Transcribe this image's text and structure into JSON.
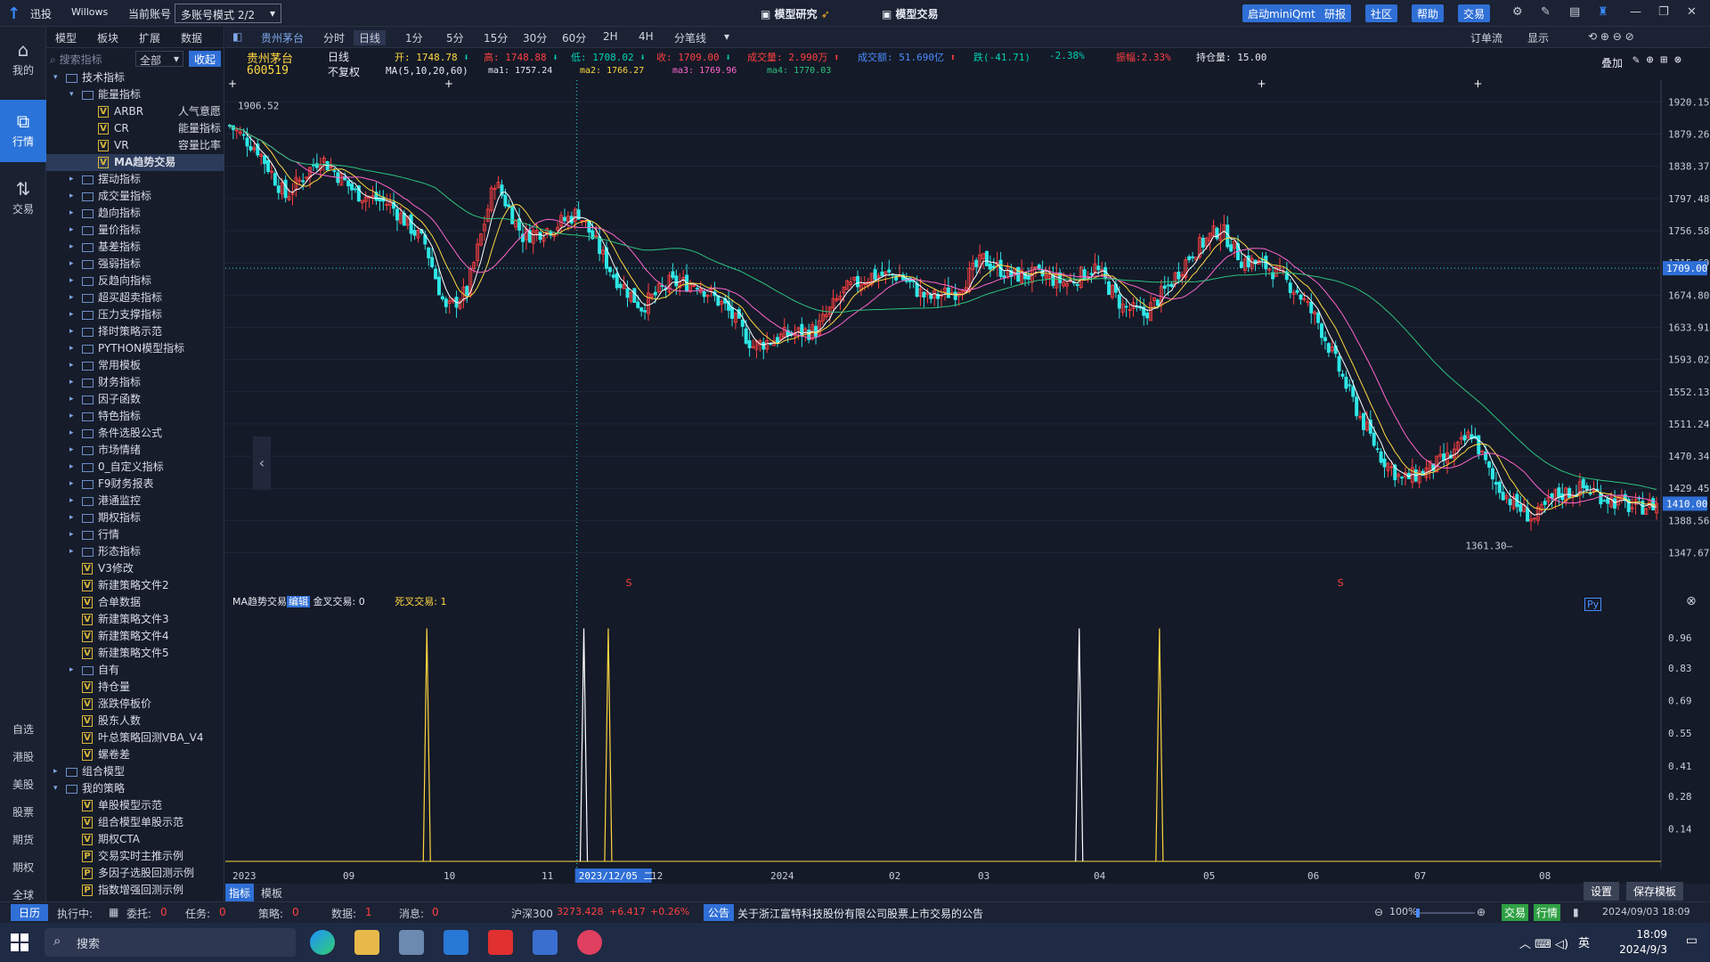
{
  "titlebar": {
    "brand": "迅投",
    "user": "Willows",
    "acct_label": "当前账号",
    "acct_value": "多账号模式 2/2",
    "center1": "模型研究",
    "center2": "模型交易",
    "buttons": [
      "启动miniQmt",
      "研报",
      "社区",
      "帮助",
      "交易"
    ]
  },
  "leftnav": {
    "items": [
      {
        "label": "我的",
        "icon": "home-icon"
      },
      {
        "label": "行情",
        "icon": "chart-icon"
      },
      {
        "label": "交易",
        "icon": "trade-icon"
      }
    ],
    "bottom": [
      "自选",
      "港股",
      "美股",
      "股票",
      "期货",
      "期权",
      "全球"
    ]
  },
  "tree": {
    "tabs": [
      "模型",
      "板块",
      "扩展",
      "数据"
    ],
    "search_placeholder": "搜索指标",
    "scope": "全部",
    "collapse": "收起",
    "rows": [
      {
        "t": "f",
        "lvl": 0,
        "open": true,
        "label": "技术指标"
      },
      {
        "t": "f",
        "lvl": 1,
        "open": true,
        "label": "能量指标"
      },
      {
        "t": "v",
        "lvl": 2,
        "label": "ARBR",
        "desc": "人气意愿"
      },
      {
        "t": "v",
        "lvl": 2,
        "label": "CR",
        "desc": "能量指标"
      },
      {
        "t": "v",
        "lvl": 2,
        "label": "VR",
        "desc": "容量比率"
      },
      {
        "t": "v",
        "lvl": 2,
        "label": "MA趋势交易",
        "desc": "",
        "sel": true
      },
      {
        "t": "f",
        "lvl": 1,
        "label": "摆动指标"
      },
      {
        "t": "f",
        "lvl": 1,
        "label": "成交量指标"
      },
      {
        "t": "f",
        "lvl": 1,
        "label": "趋向指标"
      },
      {
        "t": "f",
        "lvl": 1,
        "label": "量价指标"
      },
      {
        "t": "f",
        "lvl": 1,
        "label": "基差指标"
      },
      {
        "t": "f",
        "lvl": 1,
        "label": "强弱指标"
      },
      {
        "t": "f",
        "lvl": 1,
        "label": "反趋向指标"
      },
      {
        "t": "f",
        "lvl": 1,
        "label": "超买超卖指标"
      },
      {
        "t": "f",
        "lvl": 1,
        "label": "压力支撑指标"
      },
      {
        "t": "f",
        "lvl": 1,
        "label": "择时策略示范"
      },
      {
        "t": "f",
        "lvl": 1,
        "label": "PYTHON模型指标"
      },
      {
        "t": "f",
        "lvl": 1,
        "label": "常用模板"
      },
      {
        "t": "f",
        "lvl": 1,
        "label": "财务指标"
      },
      {
        "t": "f",
        "lvl": 1,
        "label": "因子函数"
      },
      {
        "t": "f",
        "lvl": 1,
        "label": "特色指标"
      },
      {
        "t": "f",
        "lvl": 1,
        "label": "条件选股公式"
      },
      {
        "t": "f",
        "lvl": 1,
        "label": "市场情绪"
      },
      {
        "t": "f",
        "lvl": 1,
        "label": "0_自定义指标"
      },
      {
        "t": "f",
        "lvl": 1,
        "label": "F9财务报表"
      },
      {
        "t": "f",
        "lvl": 1,
        "label": "港通监控"
      },
      {
        "t": "f",
        "lvl": 1,
        "label": "期权指标"
      },
      {
        "t": "f",
        "lvl": 1,
        "label": "行情"
      },
      {
        "t": "f",
        "lvl": 1,
        "label": "形态指标"
      },
      {
        "t": "v",
        "lvl": 1,
        "label": "V3修改"
      },
      {
        "t": "v",
        "lvl": 1,
        "label": "新建策略文件2"
      },
      {
        "t": "v",
        "lvl": 1,
        "label": "合单数据"
      },
      {
        "t": "v",
        "lvl": 1,
        "label": "新建策略文件3"
      },
      {
        "t": "v",
        "lvl": 1,
        "label": "新建策略文件4"
      },
      {
        "t": "v",
        "lvl": 1,
        "label": "新建策略文件5"
      },
      {
        "t": "f",
        "lvl": 1,
        "label": "自有"
      },
      {
        "t": "v",
        "lvl": 1,
        "label": "持仓量"
      },
      {
        "t": "v",
        "lvl": 1,
        "label": "涨跌停板价"
      },
      {
        "t": "v",
        "lvl": 1,
        "label": "股东人数"
      },
      {
        "t": "v",
        "lvl": 1,
        "label": "叶总策略回测VBA_V4"
      },
      {
        "t": "v",
        "lvl": 1,
        "label": "螺卷差"
      },
      {
        "t": "f",
        "lvl": 0,
        "label": "组合模型"
      },
      {
        "t": "f",
        "lvl": 0,
        "open": true,
        "label": "我的策略"
      },
      {
        "t": "v",
        "lvl": 1,
        "label": "单股模型示范"
      },
      {
        "t": "v",
        "lvl": 1,
        "label": "组合模型单股示范"
      },
      {
        "t": "v",
        "lvl": 1,
        "label": "期权CTA"
      },
      {
        "t": "p",
        "lvl": 1,
        "label": "交易实时主推示例"
      },
      {
        "t": "p",
        "lvl": 1,
        "label": "多因子选股回测示例"
      },
      {
        "t": "p",
        "lvl": 1,
        "label": "指数增强回测示例"
      }
    ]
  },
  "maintabs": {
    "stock": "贵州茅台",
    "tabs": [
      "分时",
      "日线",
      "1分",
      "5分",
      "15分",
      "30分",
      "60分",
      "2H",
      "4H",
      "分笔线"
    ],
    "active": "日线",
    "right": [
      "订单流",
      "显示"
    ]
  },
  "stock": {
    "name": "贵州茅台",
    "code": "600519",
    "period": "日线",
    "adj": "不复权",
    "ma_label": "MA(5,10,20,60)",
    "open": "开: 1748.78",
    "high": "高: 1748.88",
    "low": "低: 1708.02",
    "close": "收: 1709.00",
    "vol": "成交量: 2.990万",
    "amt": "成交额: 51.690亿",
    "chg": "跌(-41.71)",
    "pct": "-2.38%",
    "amp": "振幅:2.33%",
    "oi": "持仓量: 15.00",
    "ma1": "ma1: 1757.24",
    "ma2": "ma2: 1766.27",
    "ma3": "ma3: 1769.96",
    "ma4": "ma4: 1770.03",
    "overlay": "叠加"
  },
  "chart_data": [
    {
      "type": "candlestick",
      "title": "贵州茅台 600519 日线",
      "y_ticks": [
        1920.15,
        1879.26,
        1838.37,
        1797.48,
        1756.58,
        1715.69,
        1674.8,
        1633.91,
        1593.02,
        1552.13,
        1511.24,
        1470.34,
        1429.45,
        1388.56,
        1347.67
      ],
      "ylim": [
        1331.3,
        1936.5
      ],
      "last_price": "1709.00",
      "cursor_price": "1410.00",
      "high_label": "1906.52",
      "low_label": "1361.30",
      "x_ticks": [
        "2023",
        "09",
        "10",
        "11",
        "12",
        "2024",
        "02",
        "03",
        "04",
        "05",
        "06",
        "07",
        "08"
      ],
      "cursor_date": "2023/12/05 二",
      "series": [
        {
          "name": "ma1",
          "color": "#ffffff"
        },
        {
          "name": "ma2",
          "color": "#ffd740"
        },
        {
          "name": "ma3",
          "color": "#ff66cc"
        },
        {
          "name": "ma4",
          "color": "#2ec27e"
        }
      ],
      "anchors": [
        [
          0,
          1890
        ],
        [
          8,
          1860
        ],
        [
          16,
          1800
        ],
        [
          26,
          1850
        ],
        [
          36,
          1805
        ],
        [
          46,
          1790
        ],
        [
          56,
          1740
        ],
        [
          62,
          1655
        ],
        [
          68,
          1680
        ],
        [
          76,
          1820
        ],
        [
          84,
          1750
        ],
        [
          92,
          1760
        ],
        [
          100,
          1780
        ],
        [
          110,
          1700
        ],
        [
          118,
          1660
        ],
        [
          126,
          1690
        ],
        [
          134,
          1690
        ],
        [
          142,
          1660
        ],
        [
          150,
          1610
        ],
        [
          160,
          1625
        ],
        [
          168,
          1630
        ],
        [
          176,
          1680
        ],
        [
          184,
          1700
        ],
        [
          192,
          1700
        ],
        [
          200,
          1670
        ],
        [
          208,
          1680
        ],
        [
          216,
          1720
        ],
        [
          224,
          1700
        ],
        [
          232,
          1700
        ],
        [
          240,
          1690
        ],
        [
          248,
          1710
        ],
        [
          256,
          1660
        ],
        [
          262,
          1650
        ],
        [
          268,
          1680
        ],
        [
          276,
          1730
        ],
        [
          284,
          1760
        ],
        [
          290,
          1720
        ],
        [
          298,
          1710
        ],
        [
          306,
          1680
        ],
        [
          312,
          1640
        ],
        [
          318,
          1580
        ],
        [
          324,
          1520
        ],
        [
          330,
          1470
        ],
        [
          336,
          1440
        ],
        [
          342,
          1450
        ],
        [
          350,
          1470
        ],
        [
          356,
          1500
        ],
        [
          362,
          1440
        ],
        [
          368,
          1410
        ],
        [
          374,
          1390
        ],
        [
          380,
          1420
        ],
        [
          388,
          1430
        ],
        [
          396,
          1415
        ],
        [
          402,
          1405
        ],
        [
          409,
          1409
        ]
      ]
    },
    {
      "type": "line",
      "title": "MA趋势交易",
      "legend": [
        "金叉交易: 0",
        "死叉交易: 1"
      ],
      "y_ticks": [
        0.96,
        0.83,
        0.69,
        0.55,
        0.41,
        0.28,
        0.14
      ],
      "ylim": [
        0,
        1
      ],
      "spikes": [
        {
          "i": 57,
          "color": "#ffd740"
        },
        {
          "i": 102,
          "color": "#ffffff"
        },
        {
          "i": 109,
          "color": "#ffd740"
        },
        {
          "i": 244,
          "color": "#ffffff"
        },
        {
          "i": 267,
          "color": "#ffd740"
        }
      ]
    }
  ],
  "indicator": {
    "name": "MA趋势交易",
    "edit": "编辑",
    "gold": "金叉交易:",
    "gold_v": "0",
    "dead": "死叉交易:",
    "dead_v": "1"
  },
  "bottomtabs": [
    "指标",
    "模板"
  ],
  "bottomright": [
    "设置",
    "保存模板"
  ],
  "status": {
    "cal": "日历",
    "exec": "执行中:",
    "order": "委托:",
    "order_v": "0",
    "task": "任务:",
    "task_v": "0",
    "strat": "策略:",
    "strat_v": "0",
    "data": "数据:",
    "data_v": "1",
    "msg": "消息:",
    "msg_v": "0",
    "index": "沪深300",
    "idx_val": "3273.428",
    "idx_chg": "+6.417",
    "idx_pct": "+0.26%",
    "notice_tag": "公告",
    "notice": "关于浙江富特科技股份有限公司股票上市交易的公告",
    "zoom": "100%",
    "trade": "交易",
    "quote": "行情",
    "datetime": "2024/09/03 18:09"
  },
  "taskbar": {
    "search": "搜索",
    "time": "18:09",
    "date": "2024/9/3",
    "ime": "英"
  }
}
